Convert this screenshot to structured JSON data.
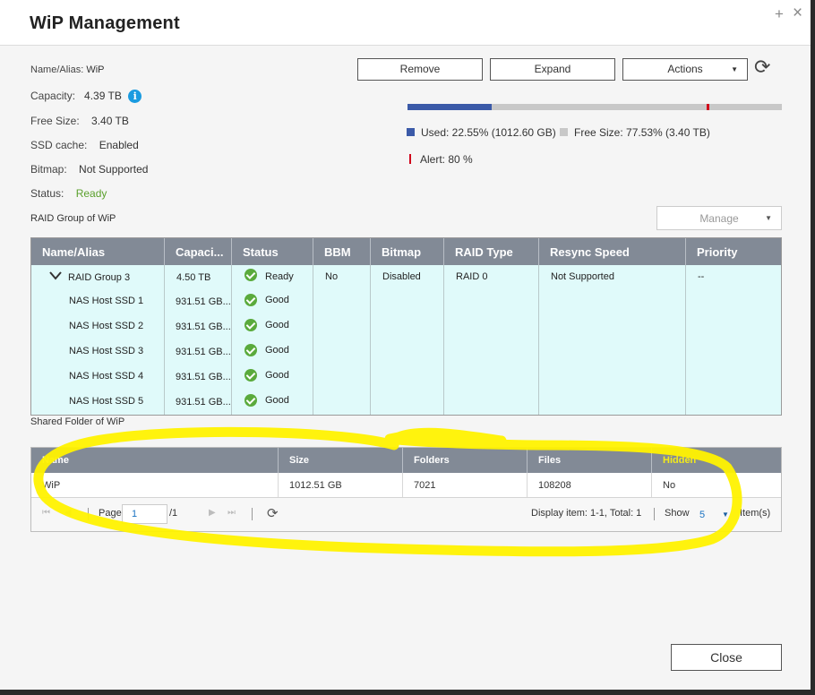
{
  "window": {
    "title": "WiP  Management",
    "controls": {
      "add_icon": "+",
      "close_icon": "×"
    }
  },
  "info": {
    "name_label": "Name/Alias:",
    "name_value": "WiP",
    "capacity_label": "Capacity:",
    "capacity_value": "4.39 TB",
    "free_label": "Free Size:",
    "free_value": "3.40 TB",
    "ssd_label": "SSD cache:",
    "ssd_value": "Enabled",
    "bitmap_label": "Bitmap:",
    "bitmap_value": "Not Supported",
    "status_label": "Status:",
    "status_value": "Ready",
    "info_icon": "i"
  },
  "toolbar": {
    "remove": "Remove",
    "expand": "Expand",
    "actions": "Actions"
  },
  "usage": {
    "used_fraction": 0.2255,
    "alert_fraction": 0.8,
    "used_label": "Used: 22.55% (1012.60 GB)",
    "free_label": "Free Size: 77.53% (3.40 TB)",
    "alert_label": "Alert: 80 %",
    "colors": {
      "used": "#3b5aa8",
      "free": "#c8c8c8",
      "alert": "#d0021b"
    }
  },
  "raid": {
    "section_title": "RAID Group of WiP",
    "manage_label": "Manage",
    "columns": [
      "Name/Alias",
      "Capaci...",
      "Status",
      "BBM",
      "Bitmap",
      "RAID Type",
      "Resync Speed",
      "Priority"
    ],
    "group": {
      "name": "RAID Group 3",
      "capacity": "4.50 TB",
      "status": "Ready",
      "bbm": "No",
      "bitmap": "Disabled",
      "raid_type": "RAID 0",
      "resync": "Not Supported",
      "priority": "--"
    },
    "disks": [
      {
        "name": "NAS Host SSD 1",
        "capacity": "931.51 GB...",
        "status": "Good"
      },
      {
        "name": "NAS Host SSD 2",
        "capacity": "931.51 GB...",
        "status": "Good"
      },
      {
        "name": "NAS Host SSD 3",
        "capacity": "931.51 GB...",
        "status": "Good"
      },
      {
        "name": "NAS Host SSD 4",
        "capacity": "931.51 GB...",
        "status": "Good"
      },
      {
        "name": "NAS Host SSD 5",
        "capacity": "931.51 GB...",
        "status": "Good"
      }
    ],
    "colors": {
      "body_bg": "#e0fafa",
      "header_bg": "#828a96",
      "ok_green": "#5aaa3c"
    }
  },
  "shared": {
    "section_title": "Shared Folder of WiP",
    "columns": [
      "Name",
      "Size",
      "Folders",
      "Files",
      "Hidden"
    ],
    "rows": [
      [
        "WiP",
        "1012.51 GB",
        "7021",
        "108208",
        "No"
      ]
    ],
    "pager": {
      "page_label": "Page",
      "page_value": "1",
      "page_total": "/1",
      "display": "Display item: 1-1, Total: 1",
      "show_label": "Show",
      "show_value": "5",
      "items_label": "Item(s)"
    }
  },
  "footer": {
    "close": "Close"
  },
  "annotation": {
    "color": "#fff200"
  }
}
